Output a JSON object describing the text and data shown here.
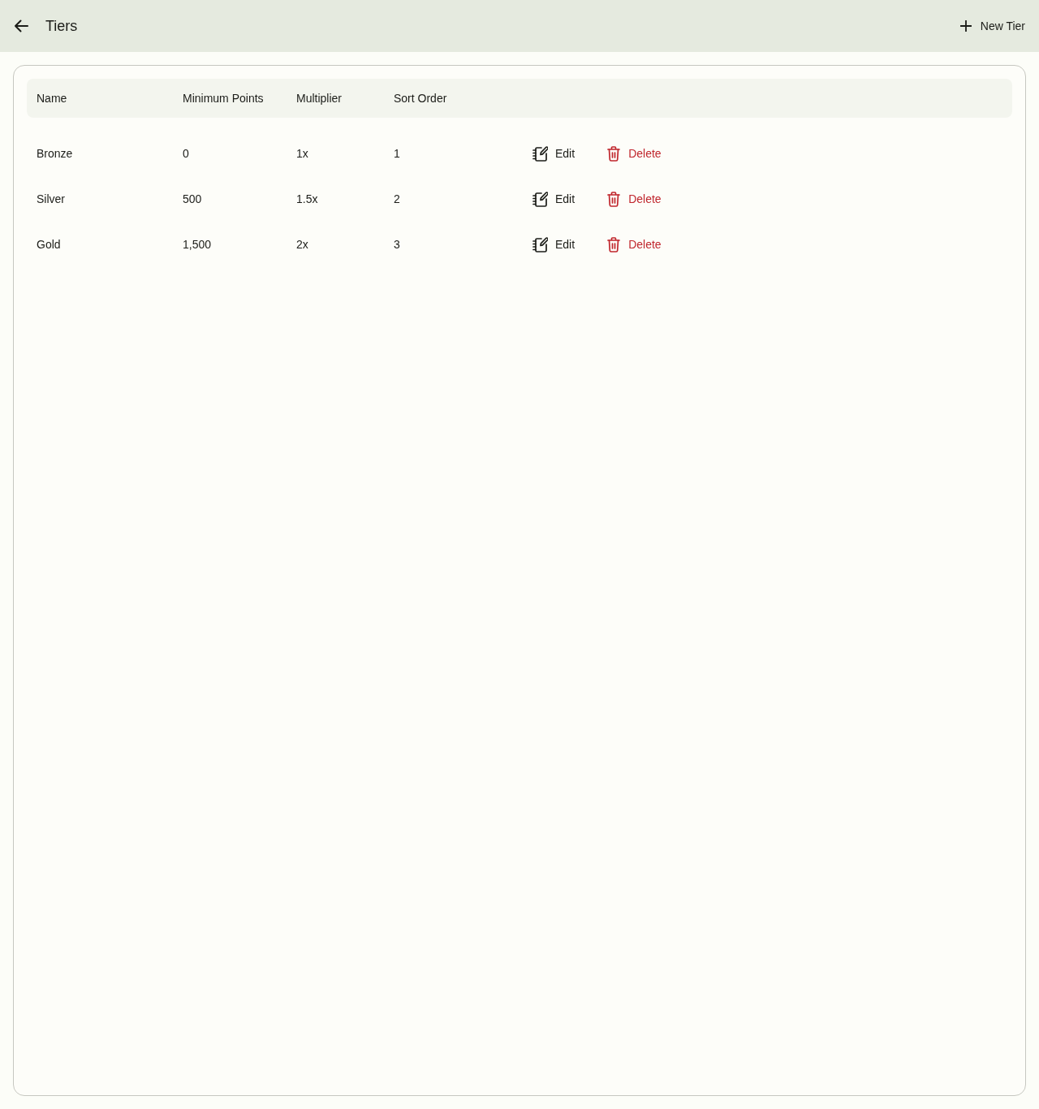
{
  "app_bar": {
    "title": "Tiers",
    "action": {
      "label": "New Tier"
    }
  },
  "table": {
    "columns": [
      "Name",
      "Minimum Points",
      "Multiplier",
      "Sort Order"
    ],
    "rows": [
      {
        "cells": [
          "Bronze",
          "0",
          "1x",
          "1"
        ],
        "actions": [
          {
            "kind": "edit",
            "label": "Edit"
          },
          {
            "kind": "delete",
            "label": "Delete"
          }
        ]
      },
      {
        "cells": [
          "Silver",
          "500",
          "1.5x",
          "2"
        ],
        "actions": [
          {
            "kind": "edit",
            "label": "Edit"
          },
          {
            "kind": "delete",
            "label": "Delete"
          }
        ]
      },
      {
        "cells": [
          "Gold",
          "1,500",
          "2x",
          "3"
        ],
        "actions": [
          {
            "kind": "edit",
            "label": "Edit"
          },
          {
            "kind": "delete",
            "label": "Delete"
          }
        ]
      }
    ]
  }
}
